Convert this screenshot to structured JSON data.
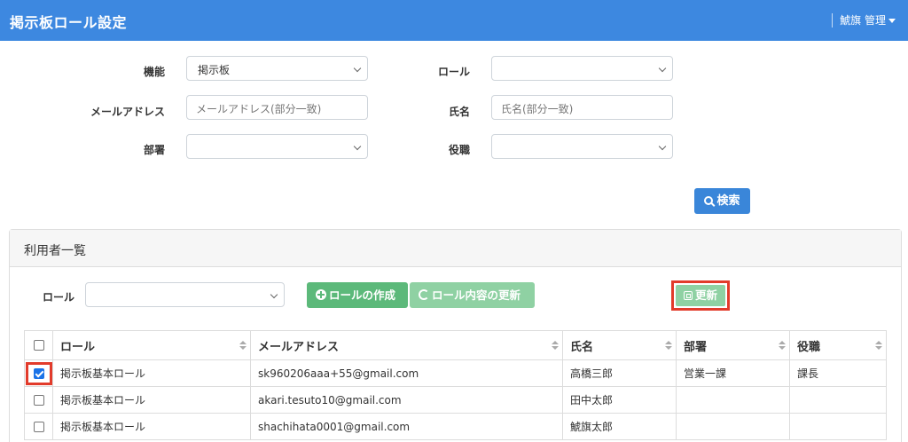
{
  "header": {
    "title": "掲示板ロール設定",
    "user": "鯱旗 管理"
  },
  "filters": {
    "feature_label": "機能",
    "feature_value": "掲示板",
    "role_label": "ロール",
    "role_value": "",
    "email_label": "メールアドレス",
    "email_placeholder": "メールアドレス(部分一致)",
    "name_label": "氏名",
    "name_placeholder": "氏名(部分一致)",
    "dept_label": "部署",
    "dept_value": "",
    "position_label": "役職",
    "position_value": "",
    "search_label": "検索"
  },
  "panel": {
    "title": "利用者一覧",
    "role_label": "ロール",
    "role_value": "",
    "create_role_label": "ロールの作成",
    "update_role_label": "ロール内容の更新",
    "update_label": "更新"
  },
  "table": {
    "columns": [
      "ロール",
      "メールアドレス",
      "氏名",
      "部署",
      "役職"
    ],
    "rows": [
      {
        "checked": true,
        "role": "掲示板基本ロール",
        "email": "sk960206aaa+55@gmail.com",
        "name": "高橋三郎",
        "dept": "営業一課",
        "position": "課長"
      },
      {
        "checked": false,
        "role": "掲示板基本ロール",
        "email": "akari.tesuto10@gmail.com",
        "name": "田中太郎",
        "dept": "",
        "position": ""
      },
      {
        "checked": false,
        "role": "掲示板基本ロール",
        "email": "shachihata0001@gmail.com",
        "name": "鯱旗太郎",
        "dept": "",
        "position": ""
      }
    ]
  },
  "colors": {
    "header": "#3d88e0",
    "search_button": "#3a86d9",
    "green_button": "#5cb97a",
    "highlight": "#e23b2b"
  }
}
